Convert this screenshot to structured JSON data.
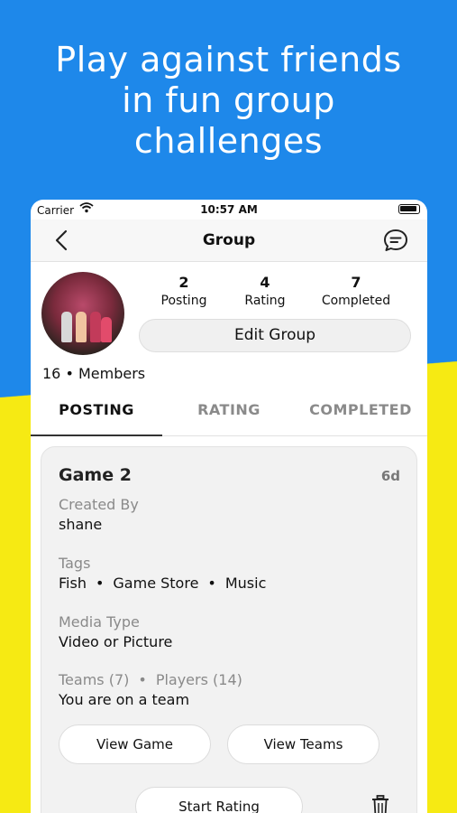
{
  "headline": {
    "line1": "Play against friends",
    "line2": "in fun group",
    "line3": "challenges"
  },
  "status_bar": {
    "carrier": "Carrier",
    "time": "10:57 AM"
  },
  "nav": {
    "title": "Group"
  },
  "stats": [
    {
      "value": "2",
      "label": "Posting"
    },
    {
      "value": "4",
      "label": "Rating"
    },
    {
      "value": "7",
      "label": "Completed"
    }
  ],
  "edit_button": "Edit Group",
  "members": "16 • Members",
  "tabs": [
    {
      "label": "POSTING",
      "active": true
    },
    {
      "label": "RATING",
      "active": false
    },
    {
      "label": "COMPLETED",
      "active": false
    }
  ],
  "game_card": {
    "title": "Game 2",
    "age": "6d",
    "created_by_label": "Created By",
    "created_by": "shane",
    "tags_label": "Tags",
    "tags": [
      "Fish",
      "Game Store",
      "Music"
    ],
    "media_type_label": "Media Type",
    "media_type": "Video or Picture",
    "teams_label": "Teams (7)",
    "players_label": "Players (14)",
    "team_status": "You are on a team",
    "view_game_button": "View Game",
    "view_teams_button": "View Teams",
    "start_rating_button": "Start Rating"
  },
  "icons": {
    "back": "chevron-left-icon",
    "chat": "chat-bubble-icon",
    "wifi": "wifi-icon",
    "battery": "battery-icon",
    "trash": "trash-icon"
  },
  "colors": {
    "top_bg": "#1e88ea",
    "bottom_bg": "#f6ea13"
  }
}
